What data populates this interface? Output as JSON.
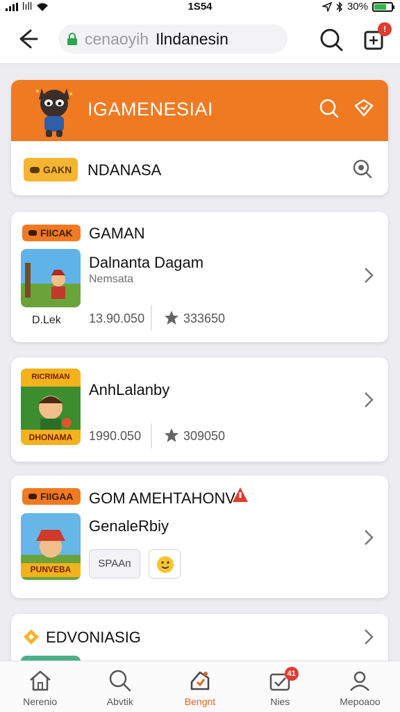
{
  "status_bar": {
    "carrier": "lıll",
    "time": "1S54",
    "battery": "30%"
  },
  "browser": {
    "url_prefix": "cenaoyih",
    "url_host": "Ilndanesin"
  },
  "header": {
    "title": "IGAMENESIAI",
    "row_badge": "GAKN",
    "row_label": "NDANASA"
  },
  "cards": [
    {
      "badge": "FIICAK",
      "section": "GAMAN",
      "title": "Dalnanta Dagam",
      "subtitle": "Nemsata",
      "thumb_caption": "D.Lek",
      "stat1": "13.90.050",
      "stat2": "333650"
    },
    {
      "title": "AnhLalanby",
      "thumb_top": "RICRIMAN",
      "thumb_bottom": "DHONAMA",
      "stat1": "1990.050",
      "stat2": "309050"
    },
    {
      "badge": "FIIGAA",
      "section": "GOM AMEHTAHONV",
      "title": "GenaleRbiy",
      "thumb_bottom": "PUNVEBA",
      "chip": "SPAAn"
    },
    {
      "section": "EDVONIASIG"
    }
  ],
  "nav": {
    "items": [
      {
        "label": "Nerenio"
      },
      {
        "label": "Abvtik"
      },
      {
        "label": "Bengnt"
      },
      {
        "label": "Nies",
        "badge": "41"
      },
      {
        "label": "Mepoaoo"
      }
    ],
    "active_color": "#e8621e"
  },
  "colors": {
    "accent": "#f07a22",
    "badge_red": "#e23b2e",
    "badge_yellow": "#f5b533"
  }
}
